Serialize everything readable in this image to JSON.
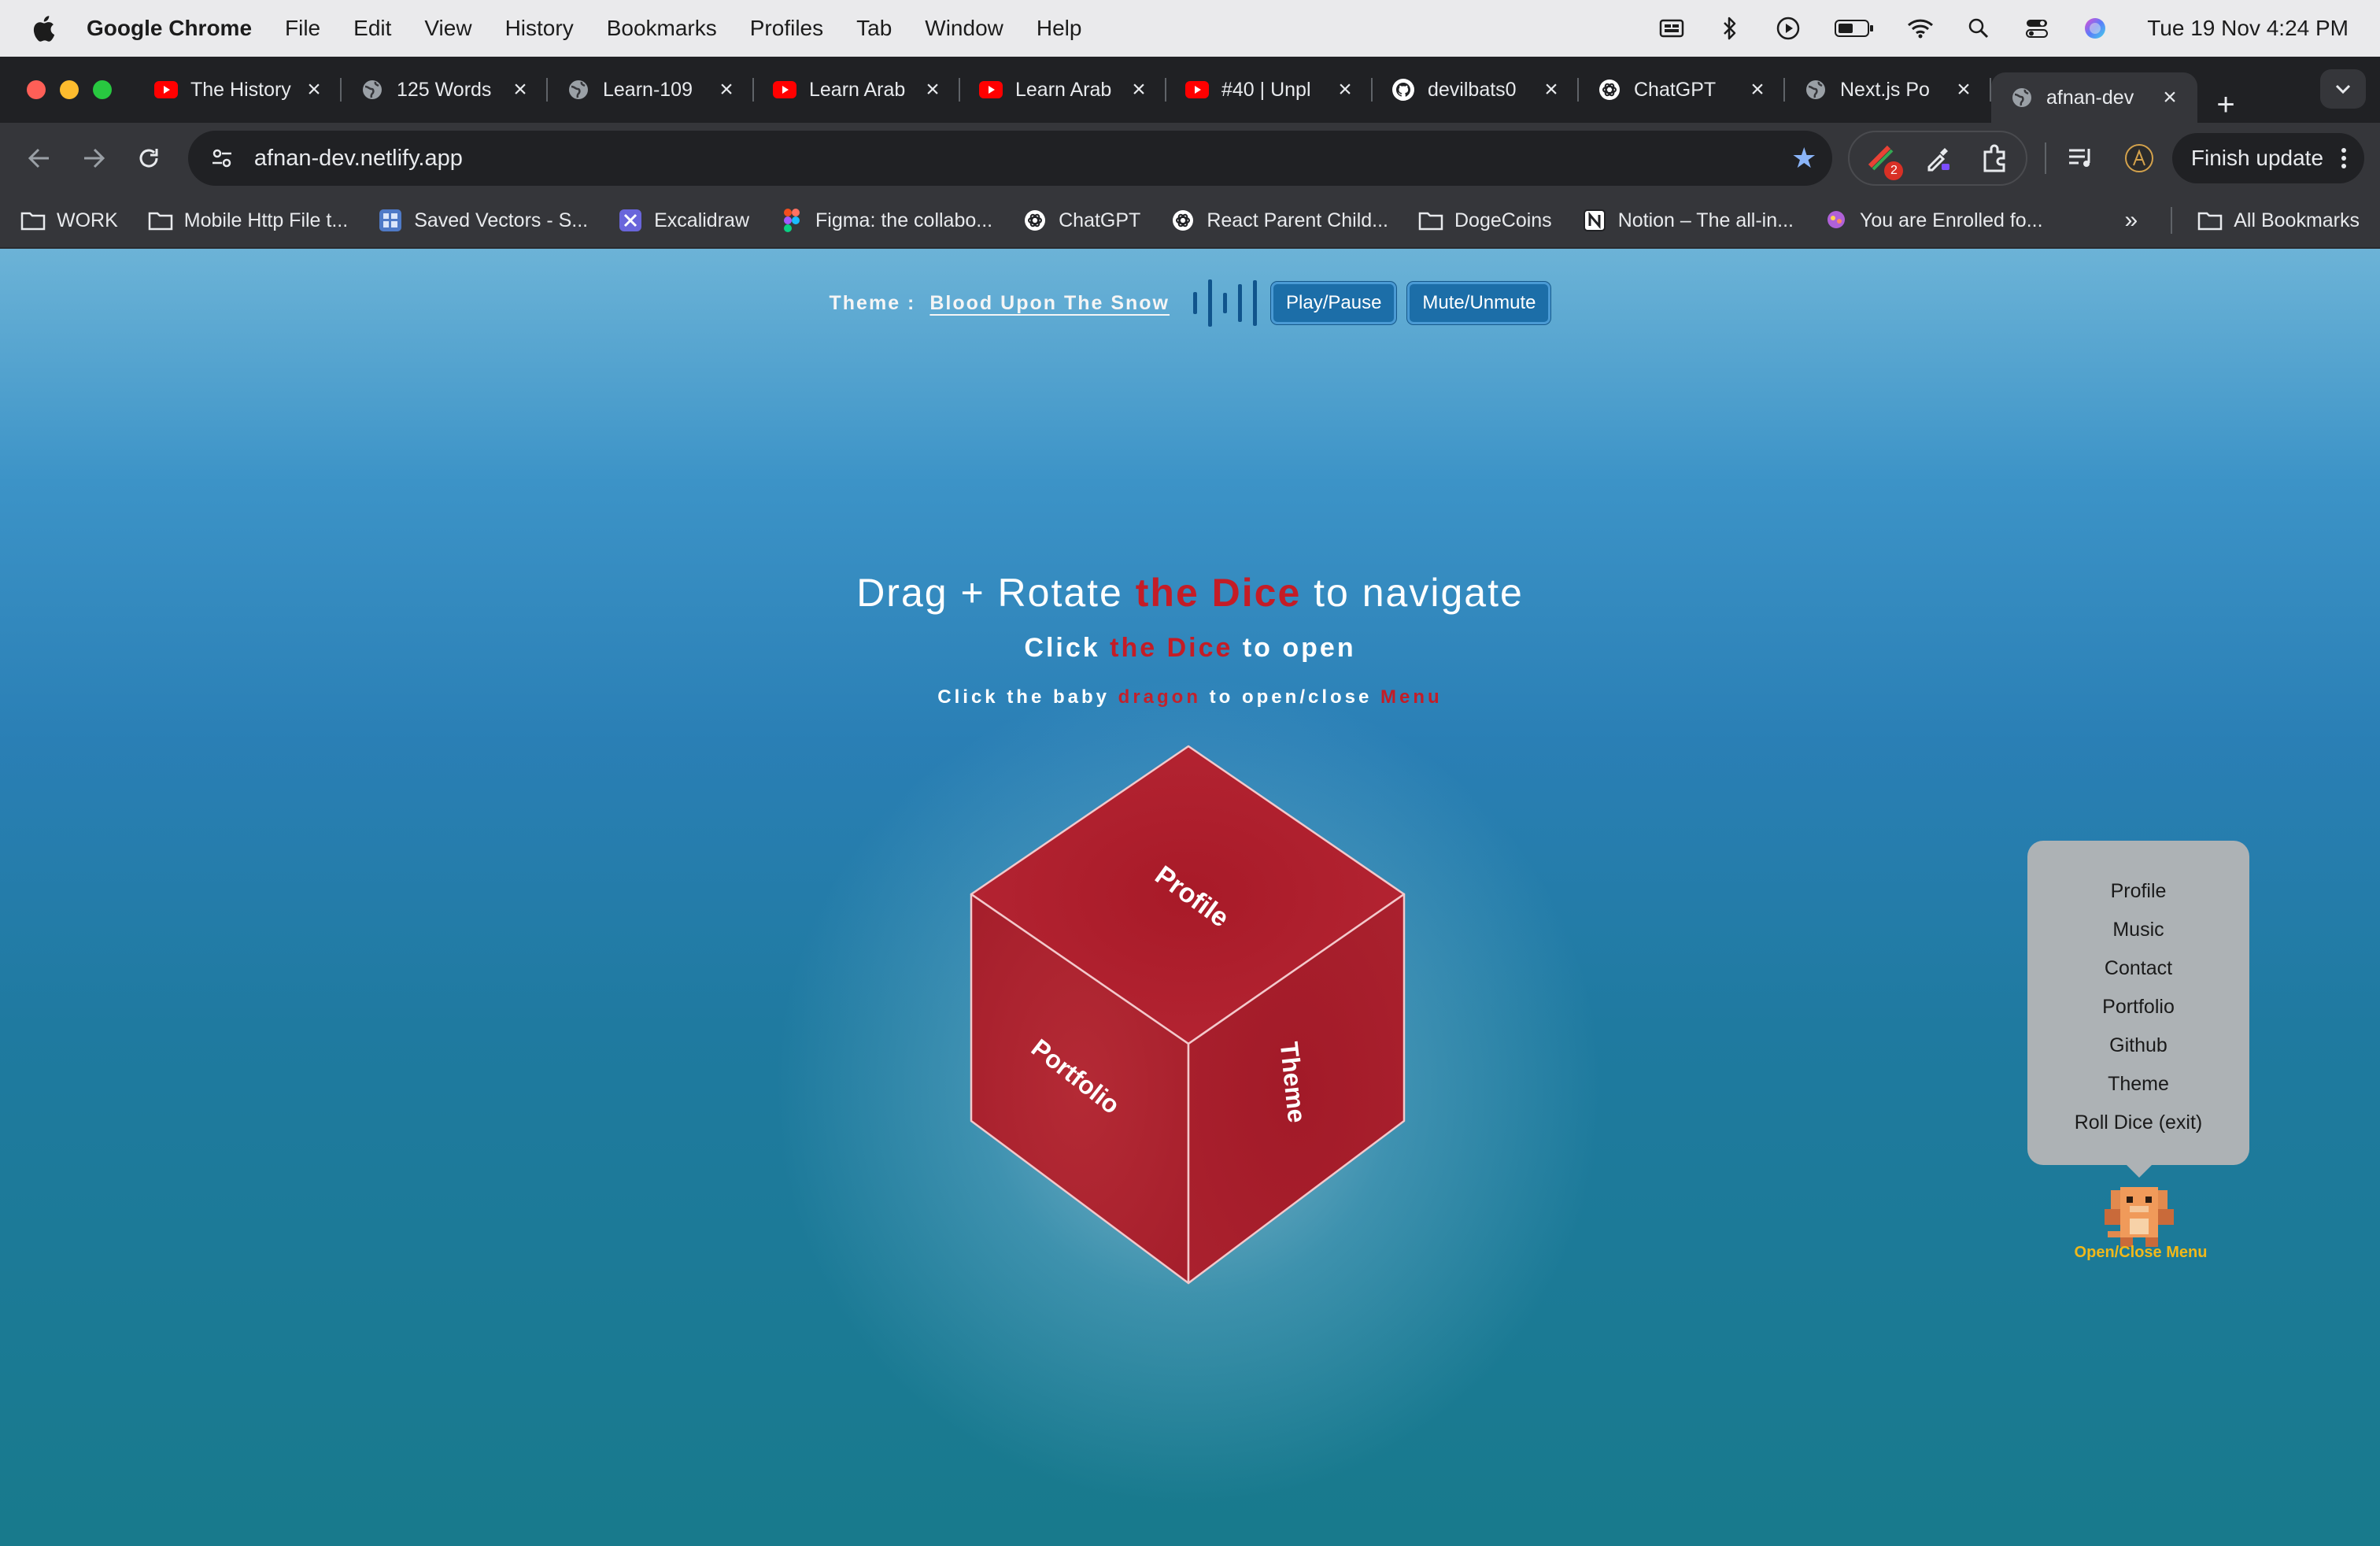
{
  "menubar": {
    "app": "Google Chrome",
    "items": [
      "File",
      "Edit",
      "View",
      "History",
      "Bookmarks",
      "Profiles",
      "Tab",
      "Window",
      "Help"
    ],
    "clock": "Tue 19 Nov  4:24 PM"
  },
  "tabs": [
    {
      "title": "The History",
      "icon": "youtube-icon"
    },
    {
      "title": "125 Words",
      "icon": "globe-icon"
    },
    {
      "title": "Learn-109",
      "icon": "globe-icon"
    },
    {
      "title": "Learn Arab",
      "icon": "youtube-icon"
    },
    {
      "title": "Learn Arab",
      "icon": "youtube-icon"
    },
    {
      "title": "#40 | Unpl",
      "icon": "youtube-icon"
    },
    {
      "title": "devilbats0",
      "icon": "github-icon"
    },
    {
      "title": "ChatGPT",
      "icon": "chatgpt-icon"
    },
    {
      "title": "Next.js Po",
      "icon": "globe-icon"
    },
    {
      "title": "afnan-dev",
      "icon": "globe-icon",
      "active": true
    }
  ],
  "toolbar": {
    "url": "afnan-dev.netlify.app",
    "extension_badge": "2",
    "finish_update": "Finish update"
  },
  "bookmarks": [
    {
      "label": "WORK",
      "icon": "folder-icon"
    },
    {
      "label": "Mobile Http File t...",
      "icon": "folder-icon"
    },
    {
      "label": "Saved Vectors - S...",
      "icon": "repo-icon"
    },
    {
      "label": "Excalidraw",
      "icon": "excalidraw-icon"
    },
    {
      "label": "Figma: the collabo...",
      "icon": "figma-icon"
    },
    {
      "label": "ChatGPT",
      "icon": "chatgpt-icon"
    },
    {
      "label": "React Parent Child...",
      "icon": "chatgpt-icon"
    },
    {
      "label": "DogeCoins",
      "icon": "folder-icon"
    },
    {
      "label": "Notion – The all-in...",
      "icon": "notion-icon"
    },
    {
      "label": "You are Enrolled fo...",
      "icon": "enrolled-icon"
    }
  ],
  "all_bookmarks": "All Bookmarks",
  "page": {
    "theme_label": "Theme :",
    "theme_name": "Blood Upon The Snow",
    "play_pause": "Play/Pause",
    "mute_unmute": "Mute/Unmute",
    "headline": {
      "pre": "Drag + Rotate ",
      "red": "the Dice",
      "post": " to navigate"
    },
    "sub1": {
      "pre": "Click ",
      "red": "the Dice",
      "post": " to open"
    },
    "sub2": {
      "pre": "Click the baby ",
      "red": "dragon",
      "mid": " to open/close ",
      "red2": "Menu"
    },
    "dice_faces": {
      "top": "Profile",
      "left": "Portfolio",
      "right": "Theme"
    },
    "menu": [
      "Profile",
      "Music",
      "Contact",
      "Portfolio",
      "Github",
      "Theme",
      "Roll Dice (exit)"
    ],
    "dragon_label": "Open/Close Menu"
  },
  "colors": {
    "accent_red": "#c41c26",
    "dice_red": "#a81c28",
    "dragon_label": "#f1b81a"
  }
}
